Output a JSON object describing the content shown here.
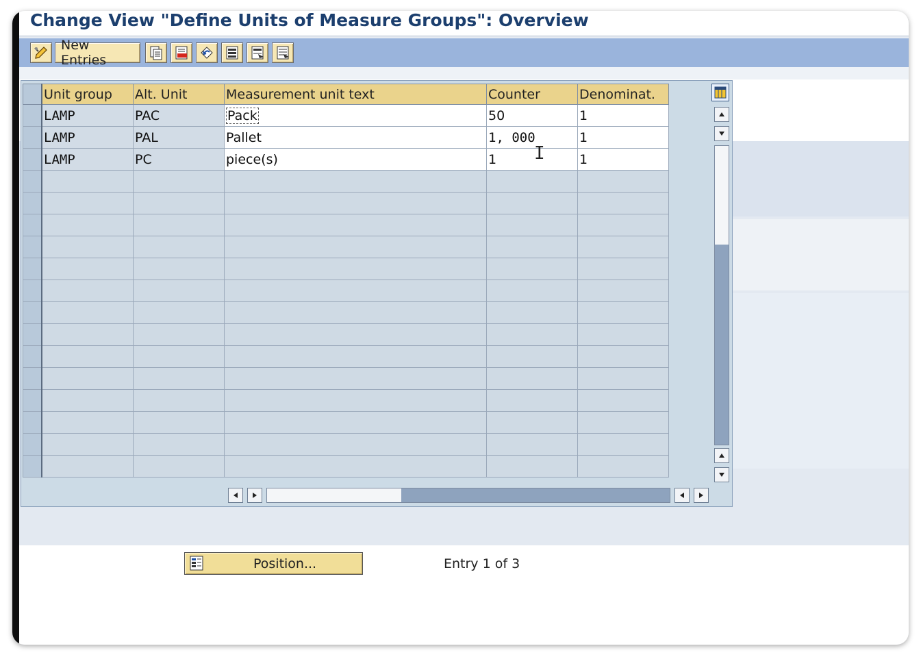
{
  "window": {
    "title": "Change View \"Define Units of Measure Groups\": Overview"
  },
  "toolbar": {
    "items": [
      {
        "name": "display-change-icon"
      },
      {
        "name": "new-entries-button",
        "label": "New Entries"
      },
      {
        "name": "copy-icon"
      },
      {
        "name": "delete-icon"
      },
      {
        "name": "undo-change-icon"
      },
      {
        "name": "select-all-icon"
      },
      {
        "name": "select-block-icon"
      },
      {
        "name": "deselect-all-icon"
      }
    ]
  },
  "table": {
    "columns": [
      "Unit group",
      "Alt. Unit",
      "Measurement unit text",
      "Counter",
      "Denominat."
    ],
    "rows": [
      {
        "unit_group": "LAMP",
        "alt_unit": "PAC",
        "text": "Pack",
        "counter": "50",
        "denominator": "1"
      },
      {
        "unit_group": "LAMP",
        "alt_unit": "PAL",
        "text": "Pallet",
        "counter": "1, 000",
        "denominator": "1"
      },
      {
        "unit_group": "LAMP",
        "alt_unit": "PC",
        "text": "piece(s)",
        "counter": "1",
        "denominator": "1"
      }
    ],
    "empty_rows": 14
  },
  "footer": {
    "position_button_label": "Position...",
    "entry_text": "Entry 1 of 3"
  },
  "colors": {
    "title": "#1c3f6e",
    "toolbar": "#9ab4dc",
    "header": "#ead38c",
    "button": "#f1de98",
    "table_panel": "#ccdbe6"
  }
}
